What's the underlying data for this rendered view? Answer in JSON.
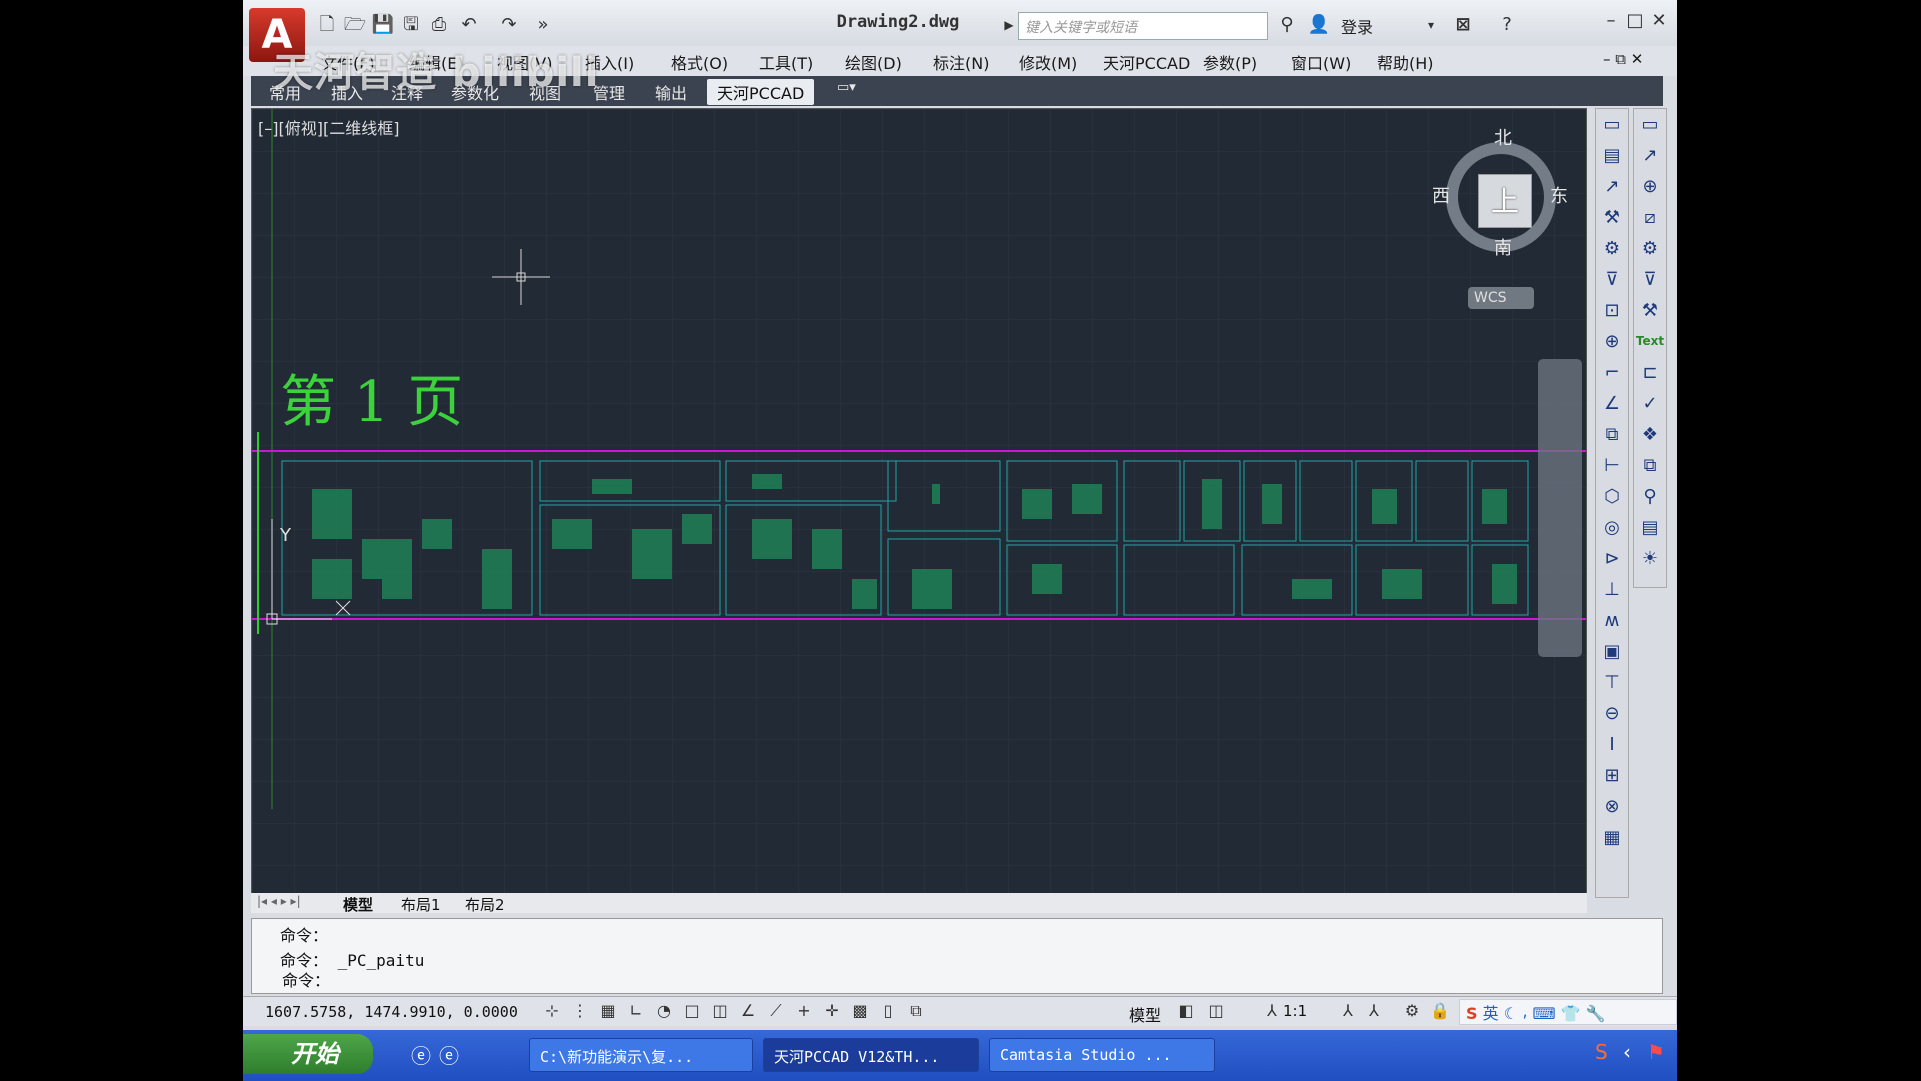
{
  "window": {
    "app_icon": "A",
    "doc_title": "Drawing2.dwg",
    "search_placeholder": "键入关键字或短语",
    "login": "登录",
    "controls": [
      "–",
      "□",
      "✕"
    ]
  },
  "watermark": "天河智造 bilibili",
  "menu": [
    "文件(F)",
    "编辑(E)",
    "视图(V)",
    "插入(I)",
    "格式(O)",
    "工具(T)",
    "绘图(D)",
    "标注(N)",
    "修改(M)",
    "天河PCCAD",
    "参数(P)",
    "窗口(W)",
    "帮助(H)"
  ],
  "ribbon_tabs": [
    "常用",
    "插入",
    "注释",
    "参数化",
    "视图",
    "管理",
    "输出",
    "天河PCCAD"
  ],
  "ribbon_active": "天河PCCAD",
  "viewport": {
    "label": "[–][俯视][二维线框]",
    "page_title": "第 1 页",
    "viewcube": {
      "face": "上",
      "north": "北",
      "south": "南",
      "east": "东",
      "west": "西",
      "wcs": "WCS"
    },
    "ucs_y": "Y",
    "ucs_x": "X"
  },
  "layout_tabs": [
    "模型",
    "布局1",
    "布局2"
  ],
  "command": {
    "lines": [
      "命令：",
      "命令： _PC_paitu"
    ],
    "prompt": "命令："
  },
  "status": {
    "coordinates": "1607.5758, 1474.9910, 0.0000",
    "model": "模型",
    "scale": "1:1",
    "ime_lang": "英"
  },
  "taskbar": {
    "start": "开始",
    "items": [
      "C:\\新功能演示\\复...",
      "天河PCCAD V12&TH...",
      "Camtasia Studio ..."
    ]
  },
  "colors": {
    "canvas_bg": "#222a35",
    "page_text": "#3bd23b",
    "frame_line": "#c21bd0",
    "drawing_lines": "#1fa7a5"
  }
}
